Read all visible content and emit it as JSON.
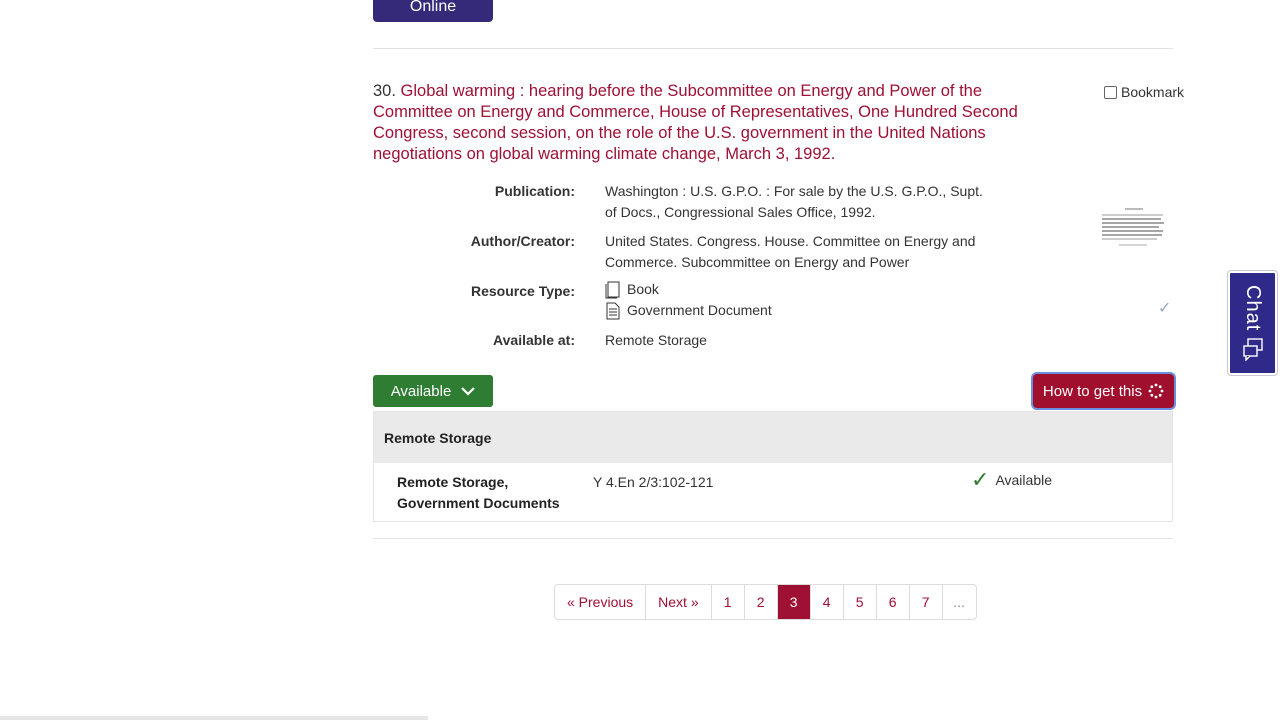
{
  "top_button": {
    "label": "Online"
  },
  "record": {
    "number": "30.",
    "title": "Global warming : hearing before the Subcommittee on Energy and Power of the Committee on Energy and Commerce, House of Representatives, One Hundred Second Congress, second session, on the role of the U.S. government in the United Nations negotiations on global warming climate change, March 3, 1992.",
    "bookmark_label": "Bookmark",
    "fields": {
      "publication_label": "Publication:",
      "publication_line1": "Washington : U.S. G.P.O. : For sale by the U.S. G.P.O., Supt.",
      "publication_line2": "of Docs., Congressional Sales Office, 1992.",
      "author_label": "Author/Creator:",
      "author_line1": "United States. Congress. House. Committee on Energy and",
      "author_line2": "Commerce. Subcommittee on Energy and Power",
      "resource_label": "Resource Type:",
      "resource_types": [
        "Book",
        "Government Document"
      ],
      "available_label": "Available at:",
      "available_value": "Remote Storage"
    },
    "available_button": "Available",
    "how_button": "How to get this"
  },
  "holdings": {
    "header": "Remote Storage",
    "location_line1": "Remote Storage,",
    "location_line2": "Government Documents",
    "call_number": "Y 4.En 2/3:102-121",
    "status": "Available"
  },
  "pagination": {
    "previous": "« Previous",
    "next": "Next »",
    "pages": [
      "1",
      "2",
      "3",
      "4",
      "5",
      "6",
      "7"
    ],
    "current": "3",
    "ellipsis": "..."
  },
  "chat": {
    "label": "Chat"
  },
  "colors": {
    "accent": "#9e1034",
    "available_green": "#2e7d32",
    "brand_purple": "#35297a"
  }
}
